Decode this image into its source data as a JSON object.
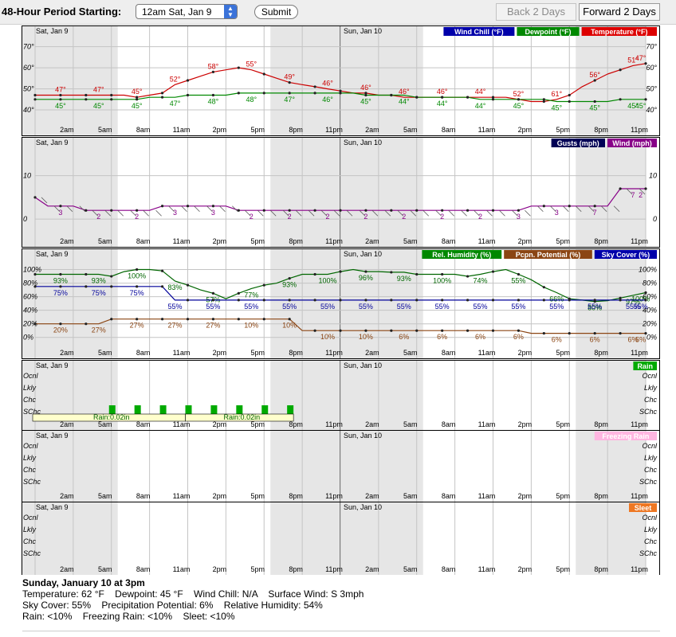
{
  "toolbar": {
    "period_label": "48-Hour Period Starting:",
    "period_value": "12am Sat, Jan 9",
    "submit_label": "Submit",
    "back_label": "Back 2 Days",
    "forward_label": "Forward 2 Days"
  },
  "chart_data": [
    {
      "id": "temperature",
      "type": "line",
      "day_labels": [
        "Sat, Jan 9",
        "Sun, Jan 10"
      ],
      "time_labels": [
        "2am",
        "5am",
        "8am",
        "11am",
        "2pm",
        "5pm",
        "8pm",
        "11pm",
        "2am",
        "5am",
        "8am",
        "11am",
        "2pm",
        "5pm",
        "8pm",
        "11pm"
      ],
      "y_ticks": [
        "40°",
        "50°",
        "60°",
        "70°"
      ],
      "legend": [
        {
          "label": "Wind Chill (°F)",
          "color": "#0000aa"
        },
        {
          "label": "Dewpoint (°F)",
          "color": "#008800"
        },
        {
          "label": "Temperature (°F)",
          "color": "#dd0000"
        }
      ],
      "ylim": [
        37,
        74
      ],
      "series": [
        {
          "name": "Temperature (°F)",
          "color": "#cc0000",
          "values": [
            47,
            47,
            47,
            47,
            47,
            47,
            47,
            47,
            46,
            47,
            48,
            52,
            54,
            56,
            58,
            59,
            60,
            59,
            57,
            55,
            53,
            52,
            51,
            50,
            49,
            48,
            48,
            47,
            47,
            46,
            46,
            46,
            46,
            46,
            46,
            46,
            46,
            46,
            45,
            44,
            44,
            45,
            47,
            51,
            54,
            57,
            59,
            61,
            62,
            61,
            59,
            57,
            56,
            55,
            54,
            53,
            52,
            51,
            50,
            49,
            48,
            47
          ],
          "labels": [
            {
              "i": 2,
              "t": "47°"
            },
            {
              "i": 5,
              "t": "47°"
            },
            {
              "i": 8,
              "t": "45°"
            },
            {
              "i": 11,
              "t": "52°"
            },
            {
              "i": 14,
              "t": "58°"
            },
            {
              "i": 17,
              "t": "55°"
            },
            {
              "i": 20,
              "t": "49°"
            },
            {
              "i": 23,
              "t": "46°"
            },
            {
              "i": 26,
              "t": "46°"
            },
            {
              "i": 29,
              "t": "46°"
            },
            {
              "i": 32,
              "t": "46°"
            },
            {
              "i": 35,
              "t": "44°"
            },
            {
              "i": 38,
              "t": "52°"
            },
            {
              "i": 41,
              "t": "61°"
            },
            {
              "i": 44,
              "t": "56°"
            },
            {
              "i": 47,
              "t": "51°"
            },
            {
              "i": 48,
              "t": "47°"
            }
          ]
        },
        {
          "name": "Dewpoint (°F)",
          "color": "#008800",
          "values": [
            45,
            45,
            45,
            45,
            45,
            45,
            45,
            45,
            45,
            46,
            46,
            46,
            47,
            47,
            47,
            47,
            48,
            48,
            48,
            48,
            48,
            48,
            48,
            48,
            48,
            48,
            47,
            47,
            47,
            47,
            46,
            46,
            46,
            46,
            46,
            45,
            45,
            45,
            45,
            45,
            45,
            44,
            44,
            44,
            44,
            44,
            45,
            45,
            45,
            45,
            45,
            45,
            45,
            45,
            45,
            45,
            45,
            45,
            45,
            45,
            45,
            45
          ],
          "labels": [
            {
              "i": 2,
              "t": "45°"
            },
            {
              "i": 5,
              "t": "45°"
            },
            {
              "i": 8,
              "t": "45°"
            },
            {
              "i": 11,
              "t": "47°"
            },
            {
              "i": 14,
              "t": "48°"
            },
            {
              "i": 17,
              "t": "48°"
            },
            {
              "i": 20,
              "t": "47°"
            },
            {
              "i": 23,
              "t": "46°"
            },
            {
              "i": 26,
              "t": "45°"
            },
            {
              "i": 29,
              "t": "44°"
            },
            {
              "i": 32,
              "t": "44°"
            },
            {
              "i": 35,
              "t": "44°"
            },
            {
              "i": 38,
              "t": "45°"
            },
            {
              "i": 41,
              "t": "45°"
            },
            {
              "i": 44,
              "t": "45°"
            },
            {
              "i": 47,
              "t": "45°"
            },
            {
              "i": 48,
              "t": "45°"
            }
          ]
        }
      ]
    },
    {
      "id": "wind",
      "type": "line",
      "day_labels": [
        "Sat, Jan 9",
        "Sun, Jan 10"
      ],
      "time_labels": [
        "2am",
        "5am",
        "8am",
        "11am",
        "2pm",
        "5pm",
        "8pm",
        "11pm",
        "2am",
        "5am",
        "8am",
        "11am",
        "2pm",
        "5pm",
        "8pm",
        "11pm"
      ],
      "y_ticks": [
        "0",
        "10"
      ],
      "legend": [
        {
          "label": "Gusts (mph)",
          "color": "#000055"
        },
        {
          "label": "Wind (mph)",
          "color": "#880088"
        }
      ],
      "ylim": [
        -2,
        16
      ],
      "series": [
        {
          "name": "Wind (mph)",
          "color": "#880088",
          "values": [
            5,
            3,
            3,
            3,
            2,
            2,
            2,
            2,
            2,
            2,
            3,
            3,
            3,
            3,
            3,
            3,
            2,
            2,
            2,
            2,
            2,
            2,
            2,
            2,
            2,
            2,
            2,
            2,
            2,
            2,
            2,
            2,
            2,
            2,
            2,
            2,
            2,
            2,
            2,
            3,
            3,
            3,
            3,
            3,
            3,
            3,
            7,
            7,
            7,
            7,
            7,
            7,
            7,
            7,
            7,
            7,
            7,
            2,
            2,
            2,
            2,
            2
          ],
          "labels": [
            {
              "i": 2,
              "t": "3"
            },
            {
              "i": 5,
              "t": "2"
            },
            {
              "i": 8,
              "t": "2"
            },
            {
              "i": 11,
              "t": "3"
            },
            {
              "i": 14,
              "t": "3"
            },
            {
              "i": 17,
              "t": "2"
            },
            {
              "i": 20,
              "t": "2"
            },
            {
              "i": 23,
              "t": "2"
            },
            {
              "i": 26,
              "t": "2"
            },
            {
              "i": 29,
              "t": "2"
            },
            {
              "i": 32,
              "t": "2"
            },
            {
              "i": 35,
              "t": "2"
            },
            {
              "i": 38,
              "t": "3"
            },
            {
              "i": 41,
              "t": "3"
            },
            {
              "i": 44,
              "t": "7"
            },
            {
              "i": 47,
              "t": "7"
            },
            {
              "i": 48,
              "t": "2"
            }
          ]
        }
      ]
    },
    {
      "id": "humidity",
      "type": "line",
      "day_labels": [
        "Sat, Jan 9",
        "Sun, Jan 10"
      ],
      "time_labels": [
        "2am",
        "5am",
        "8am",
        "11am",
        "2pm",
        "5pm",
        "8pm",
        "11pm",
        "2am",
        "5am",
        "8am",
        "11am",
        "2pm",
        "5pm",
        "8pm",
        "11pm"
      ],
      "y_ticks": [
        "0%",
        "20%",
        "40%",
        "60%",
        "80%",
        "100%"
      ],
      "legend": [
        {
          "label": "Rel. Humidity (%)",
          "color": "#008800"
        },
        {
          "label": "Pcpn. Potential (%)",
          "color": "#8b4513"
        },
        {
          "label": "Sky Cover (%)",
          "color": "#0000aa"
        }
      ],
      "ylim": [
        -5,
        110
      ],
      "series": [
        {
          "name": "Rel. Humidity (%)",
          "color": "#006600",
          "values": [
            93,
            93,
            93,
            93,
            93,
            93,
            90,
            97,
            100,
            100,
            98,
            83,
            77,
            70,
            65,
            57,
            65,
            72,
            77,
            80,
            87,
            93,
            93,
            93,
            97,
            100,
            97,
            97,
            96,
            96,
            93,
            93,
            93,
            93,
            90,
            93,
            97,
            100,
            93,
            85,
            74,
            66,
            57,
            55,
            53,
            54,
            58,
            62,
            66,
            70,
            73,
            76,
            80,
            83,
            86,
            90,
            93,
            97,
            100,
            100,
            100,
            100
          ],
          "labels": [
            {
              "i": 2,
              "t": "93%"
            },
            {
              "i": 5,
              "t": "93%"
            },
            {
              "i": 8,
              "t": "100%"
            },
            {
              "i": 11,
              "t": "83%"
            },
            {
              "i": 14,
              "t": "57%"
            },
            {
              "i": 17,
              "t": "77%"
            },
            {
              "i": 20,
              "t": "93%"
            },
            {
              "i": 23,
              "t": "100%"
            },
            {
              "i": 26,
              "t": "96%"
            },
            {
              "i": 29,
              "t": "93%"
            },
            {
              "i": 32,
              "t": "100%"
            },
            {
              "i": 35,
              "t": "74%"
            },
            {
              "i": 38,
              "t": "55%"
            },
            {
              "i": 41,
              "t": "66%"
            },
            {
              "i": 44,
              "t": "80%"
            },
            {
              "i": 47,
              "t": "97%"
            },
            {
              "i": 48,
              "t": "100%"
            }
          ]
        },
        {
          "name": "Sky Cover (%)",
          "color": "#000099",
          "values": [
            75,
            75,
            75,
            75,
            75,
            75,
            75,
            75,
            75,
            75,
            75,
            55,
            55,
            55,
            55,
            55,
            55,
            55,
            55,
            55,
            55,
            55,
            55,
            55,
            55,
            55,
            55,
            55,
            55,
            55,
            55,
            55,
            55,
            55,
            55,
            55,
            55,
            55,
            55,
            55,
            55,
            55,
            55,
            55,
            55,
            55,
            55,
            55,
            55,
            55,
            55,
            55,
            55,
            55,
            55,
            55,
            55,
            55,
            55,
            55,
            55,
            55
          ],
          "labels": [
            {
              "i": 2,
              "t": "75%"
            },
            {
              "i": 5,
              "t": "75%"
            },
            {
              "i": 8,
              "t": "75%"
            },
            {
              "i": 11,
              "t": "55%"
            },
            {
              "i": 14,
              "t": "55%"
            },
            {
              "i": 17,
              "t": "55%"
            },
            {
              "i": 20,
              "t": "55%"
            },
            {
              "i": 23,
              "t": "55%"
            },
            {
              "i": 26,
              "t": "55%"
            },
            {
              "i": 29,
              "t": "55%"
            },
            {
              "i": 32,
              "t": "55%"
            },
            {
              "i": 35,
              "t": "55%"
            },
            {
              "i": 38,
              "t": "55%"
            },
            {
              "i": 41,
              "t": "55%"
            },
            {
              "i": 44,
              "t": "55%"
            },
            {
              "i": 47,
              "t": "55%"
            },
            {
              "i": 48,
              "t": "55%"
            }
          ]
        },
        {
          "name": "Pcpn. Potential (%)",
          "color": "#8b4513",
          "values": [
            20,
            20,
            20,
            20,
            20,
            20,
            27,
            27,
            27,
            27,
            27,
            27,
            27,
            27,
            27,
            27,
            27,
            27,
            27,
            27,
            27,
            10,
            10,
            10,
            10,
            10,
            10,
            10,
            10,
            10,
            10,
            10,
            10,
            10,
            10,
            10,
            10,
            10,
            10,
            6,
            6,
            6,
            6,
            6,
            6,
            6,
            6,
            6,
            6,
            6,
            6,
            6,
            6,
            6,
            6,
            6,
            6,
            6,
            6,
            6,
            6,
            6
          ],
          "labels": [
            {
              "i": 2,
              "t": "20%"
            },
            {
              "i": 5,
              "t": "27%"
            },
            {
              "i": 8,
              "t": "27%"
            },
            {
              "i": 11,
              "t": "27%"
            },
            {
              "i": 14,
              "t": "27%"
            },
            {
              "i": 17,
              "t": "10%"
            },
            {
              "i": 20,
              "t": "10%"
            },
            {
              "i": 23,
              "t": "10%"
            },
            {
              "i": 26,
              "t": "10%"
            },
            {
              "i": 29,
              "t": "6%"
            },
            {
              "i": 32,
              "t": "6%"
            },
            {
              "i": 35,
              "t": "6%"
            },
            {
              "i": 38,
              "t": "6%"
            },
            {
              "i": 41,
              "t": "6%"
            },
            {
              "i": 44,
              "t": "6%"
            },
            {
              "i": 47,
              "t": "6%"
            },
            {
              "i": 48,
              "t": "6%"
            }
          ]
        }
      ]
    },
    {
      "id": "rain",
      "type": "bar",
      "day_labels": [
        "Sat, Jan 9",
        "Sun, Jan 10"
      ],
      "y_ticks": [
        "Ocnl",
        "Lkly",
        "Chc",
        "SChc"
      ],
      "legend": [
        {
          "label": "Rain",
          "color": "#00aa00"
        }
      ],
      "levels": [
        1,
        1,
        1,
        1,
        1,
        2,
        2,
        2,
        2,
        2,
        2,
        2,
        2,
        2,
        2,
        2,
        2,
        2,
        2,
        2,
        2,
        0,
        0,
        0,
        0,
        0,
        0,
        0,
        0,
        0,
        0,
        0,
        0,
        0,
        0,
        0,
        0,
        0,
        0,
        0,
        0,
        0,
        0,
        0,
        0,
        0,
        0,
        0,
        0,
        0,
        0,
        0,
        0,
        0,
        0,
        0,
        0,
        0,
        0,
        0,
        0,
        0
      ],
      "amounts": [
        {
          "text": "Rain:0.02in"
        },
        {
          "text": "Rain:0.02in"
        }
      ]
    },
    {
      "id": "freezing_rain",
      "type": "bar",
      "day_labels": [
        "Sat, Jan 9",
        "Sun, Jan 10"
      ],
      "y_ticks": [
        "Ocnl",
        "Lkly",
        "Chc",
        "SChc"
      ],
      "legend": [
        {
          "label": "Freezing Rain",
          "color": "#ffb6e1"
        }
      ],
      "levels": [],
      "amounts": []
    },
    {
      "id": "sleet",
      "type": "bar",
      "day_labels": [
        "Sat, Jan 9",
        "Sun, Jan 10"
      ],
      "time_labels": [
        "2am",
        "5am",
        "8am",
        "11am",
        "2pm",
        "5pm",
        "8pm",
        "11pm",
        "2am",
        "5am",
        "8am",
        "11am",
        "2pm",
        "5pm",
        "8pm",
        "11pm"
      ],
      "y_ticks": [
        "Ocnl",
        "Lkly",
        "Chc",
        "SChc"
      ],
      "legend": [
        {
          "label": "Sleet",
          "color": "#ee7722"
        }
      ],
      "levels": [],
      "amounts": []
    }
  ],
  "summary": {
    "title": "Sunday, January 10 at 3pm",
    "line1": "Temperature: 62 °F    Dewpoint: 45 °F    Wind Chill: N/A    Surface Wind: S 3mph",
    "line2": "Sky Cover: 55%    Precipitation Potential: 6%    Relative Humidity: 54%",
    "line3": "Rain: <10%    Freezing Rain: <10%    Sleet: <10%"
  }
}
